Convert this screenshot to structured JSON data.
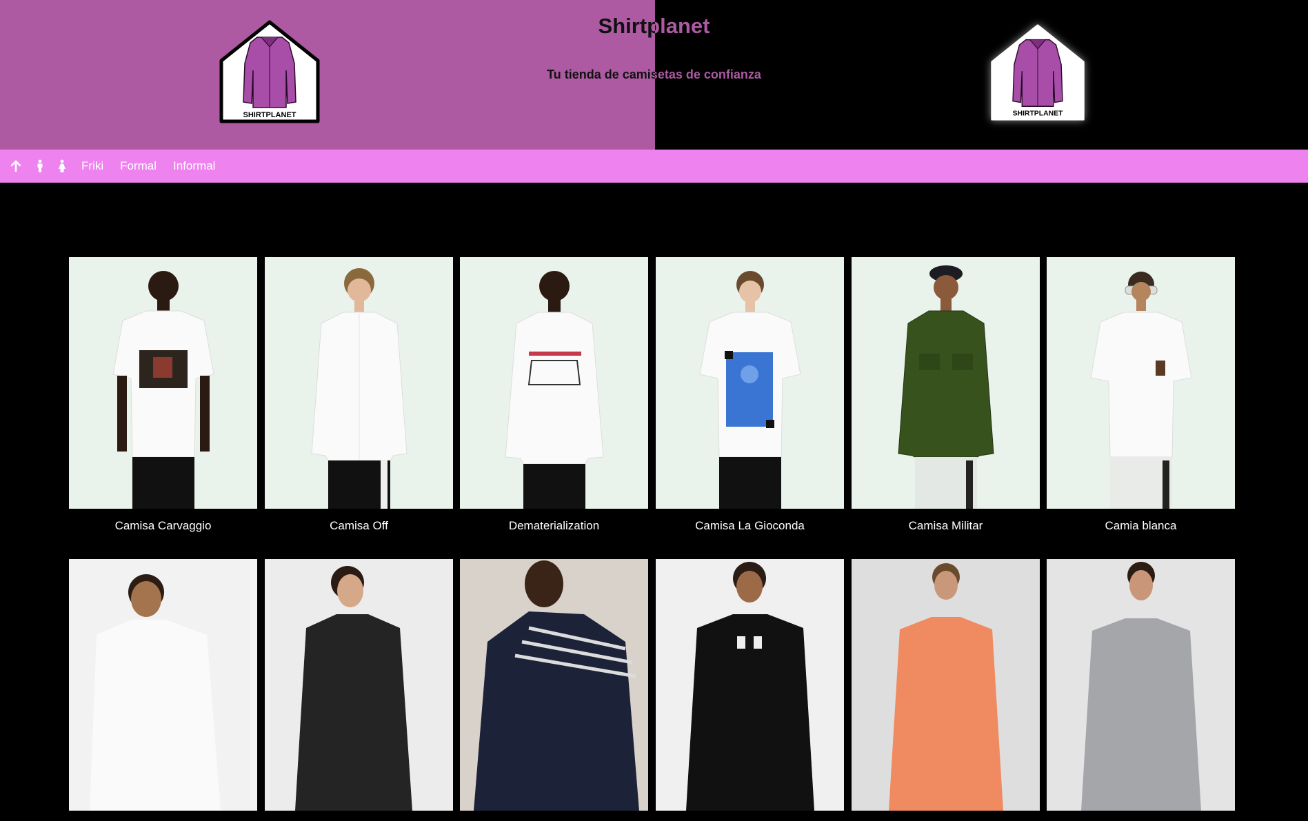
{
  "header": {
    "title": "Shirtplanet",
    "tagline": "Tu tienda de camisetas de confianza",
    "logo_text": "SHIRTPLANET",
    "colors": {
      "left_bg": "#ad5aa2",
      "right_bg": "#000000",
      "nav_bg": "#ee82ee"
    }
  },
  "nav": {
    "items": [
      {
        "icon": "arrow-up-icon",
        "label": ""
      },
      {
        "icon": "male-icon",
        "label": ""
      },
      {
        "icon": "female-icon",
        "label": ""
      },
      {
        "icon": "",
        "label": "Friki"
      },
      {
        "icon": "",
        "label": "Formal"
      },
      {
        "icon": "",
        "label": "Informal"
      }
    ]
  },
  "products": [
    {
      "name": "Camisa Carvaggio"
    },
    {
      "name": "Camisa Off"
    },
    {
      "name": "Dematerialization"
    },
    {
      "name": "Camisa La Gioconda"
    },
    {
      "name": "Camisa Militar"
    },
    {
      "name": "Camia blanca"
    },
    {
      "name": ""
    },
    {
      "name": ""
    },
    {
      "name": ""
    },
    {
      "name": ""
    },
    {
      "name": ""
    },
    {
      "name": ""
    }
  ]
}
